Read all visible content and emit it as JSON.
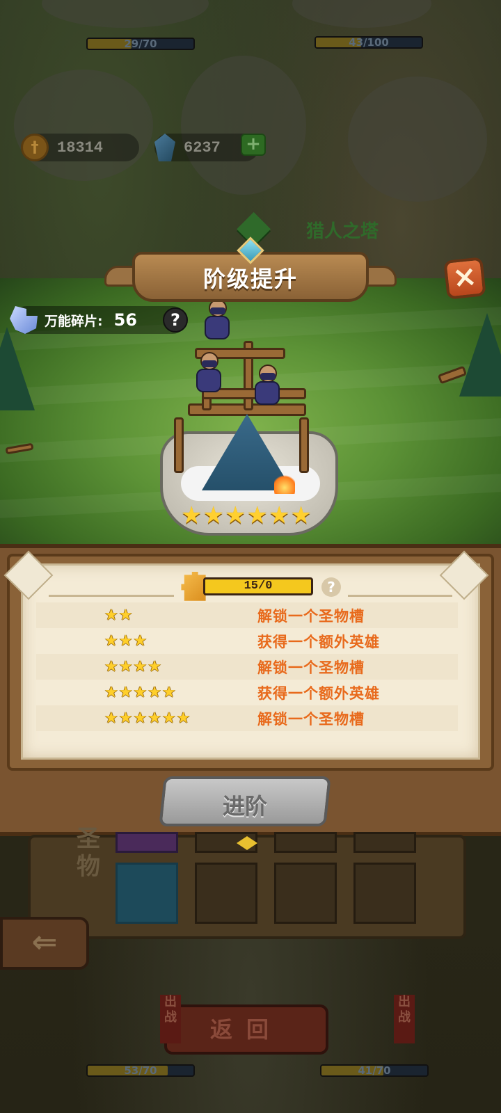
{
  "background": {
    "top_bars": [
      {
        "text": "29/70",
        "fill": 0.414
      },
      {
        "text": "43/100",
        "fill": 0.43
      }
    ],
    "bottom_bars": [
      {
        "text": "53/70",
        "fill": 0.757
      },
      {
        "text": "41/70",
        "fill": 0.586
      }
    ],
    "gold_amount": "18314",
    "gem_amount": "6237",
    "tower_name": "猎人之塔",
    "relic_label": "圣物",
    "return_label": "返回",
    "side_tag": "出战"
  },
  "modal": {
    "title": "阶级提升",
    "shard_label": "万能碎片:",
    "shard_count": "56",
    "star_level": 6,
    "progress": {
      "text": "15/0",
      "fill": 1.0
    },
    "rewards": [
      {
        "stars": 2,
        "text": "解锁一个圣物槽"
      },
      {
        "stars": 3,
        "text": "获得一个额外英雄"
      },
      {
        "stars": 4,
        "text": "解锁一个圣物槽"
      },
      {
        "stars": 5,
        "text": "获得一个额外英雄"
      },
      {
        "stars": 6,
        "text": "解锁一个圣物槽"
      }
    ],
    "advance_label": "进阶"
  },
  "icons": {
    "close": "close-icon",
    "help": "question-icon",
    "back": "arrow-left-icon",
    "shard": "puzzle-shard-icon"
  },
  "colors": {
    "grass": "#6ea840",
    "parchment": "#f4ebd6",
    "reward_text": "#e86a1c",
    "star": "#ffcf2a",
    "progress_fill": "#f4c81e"
  }
}
